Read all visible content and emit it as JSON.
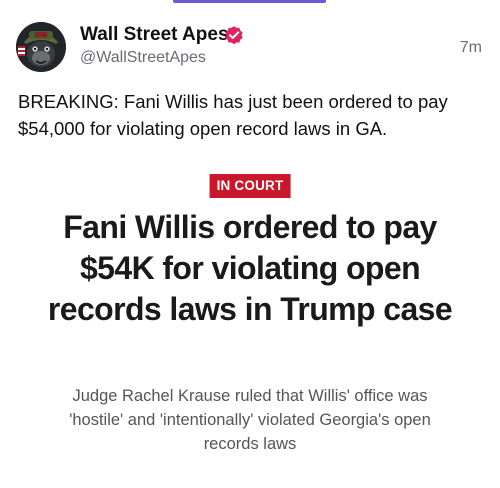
{
  "post": {
    "author_name": "Wall Street Apes",
    "handle": "@WallStreetApes",
    "timestamp": "7m",
    "text": "BREAKING: Fani Willis has just been ordered to pay $54,000 for violating open record laws in GA.",
    "verified_badge_color": "#e0245e"
  },
  "article": {
    "tag": "IN COURT",
    "tag_color": "#c9182b",
    "headline": "Fani Willis ordered to pay $54K for violating open records laws in Trump case",
    "subheadline": "Judge Rachel Krause ruled that Willis' office was 'hostile' and 'intentionally' violated Georgia's open records laws"
  },
  "icons": {
    "avatar": "ape-avatar-icon",
    "verified": "verified-badge-icon"
  }
}
